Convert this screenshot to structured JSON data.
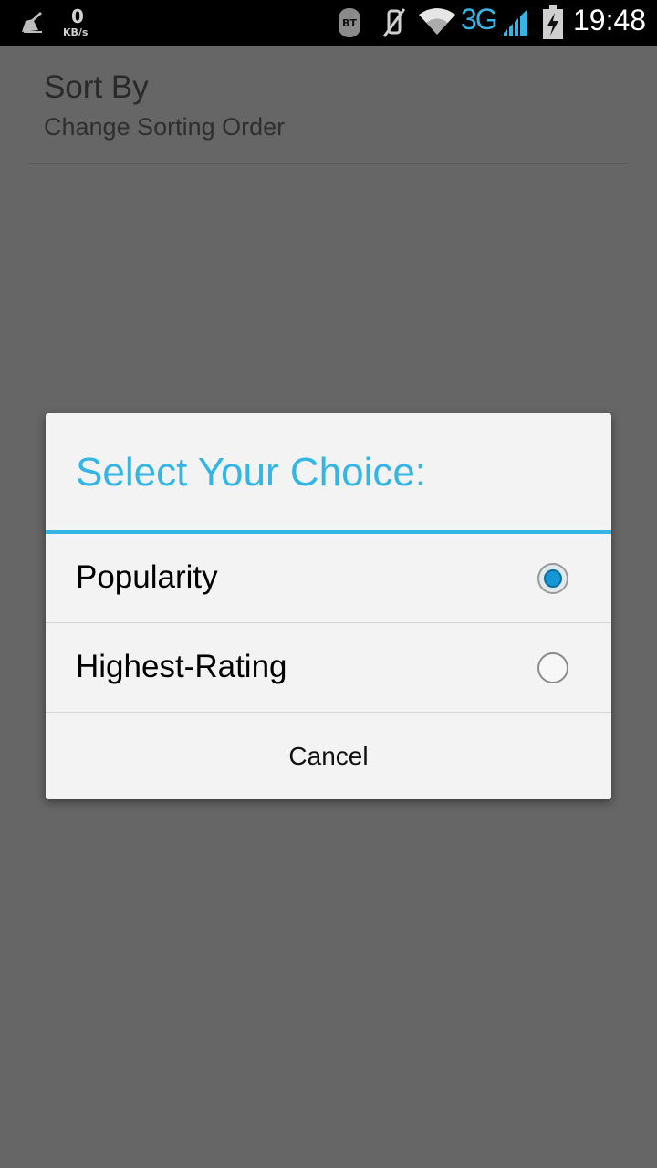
{
  "status_bar": {
    "data_rate_value": "0",
    "data_rate_unit": "KB/s",
    "bluetooth_label": "BT",
    "network_type": "3G",
    "time": "19:48",
    "icons": [
      "cleaner-icon",
      "bluetooth-icon",
      "mute-icon",
      "wifi-icon",
      "signal-icon",
      "battery-charging-icon"
    ]
  },
  "preference": {
    "title": "Sort By",
    "summary": "Change Sorting Order"
  },
  "dialog": {
    "title": "Select Your Choice:",
    "options": [
      {
        "label": "Popularity",
        "selected": true
      },
      {
        "label": "Highest-Rating",
        "selected": false
      }
    ],
    "cancel_label": "Cancel",
    "accent_color": "#33b5e5"
  }
}
